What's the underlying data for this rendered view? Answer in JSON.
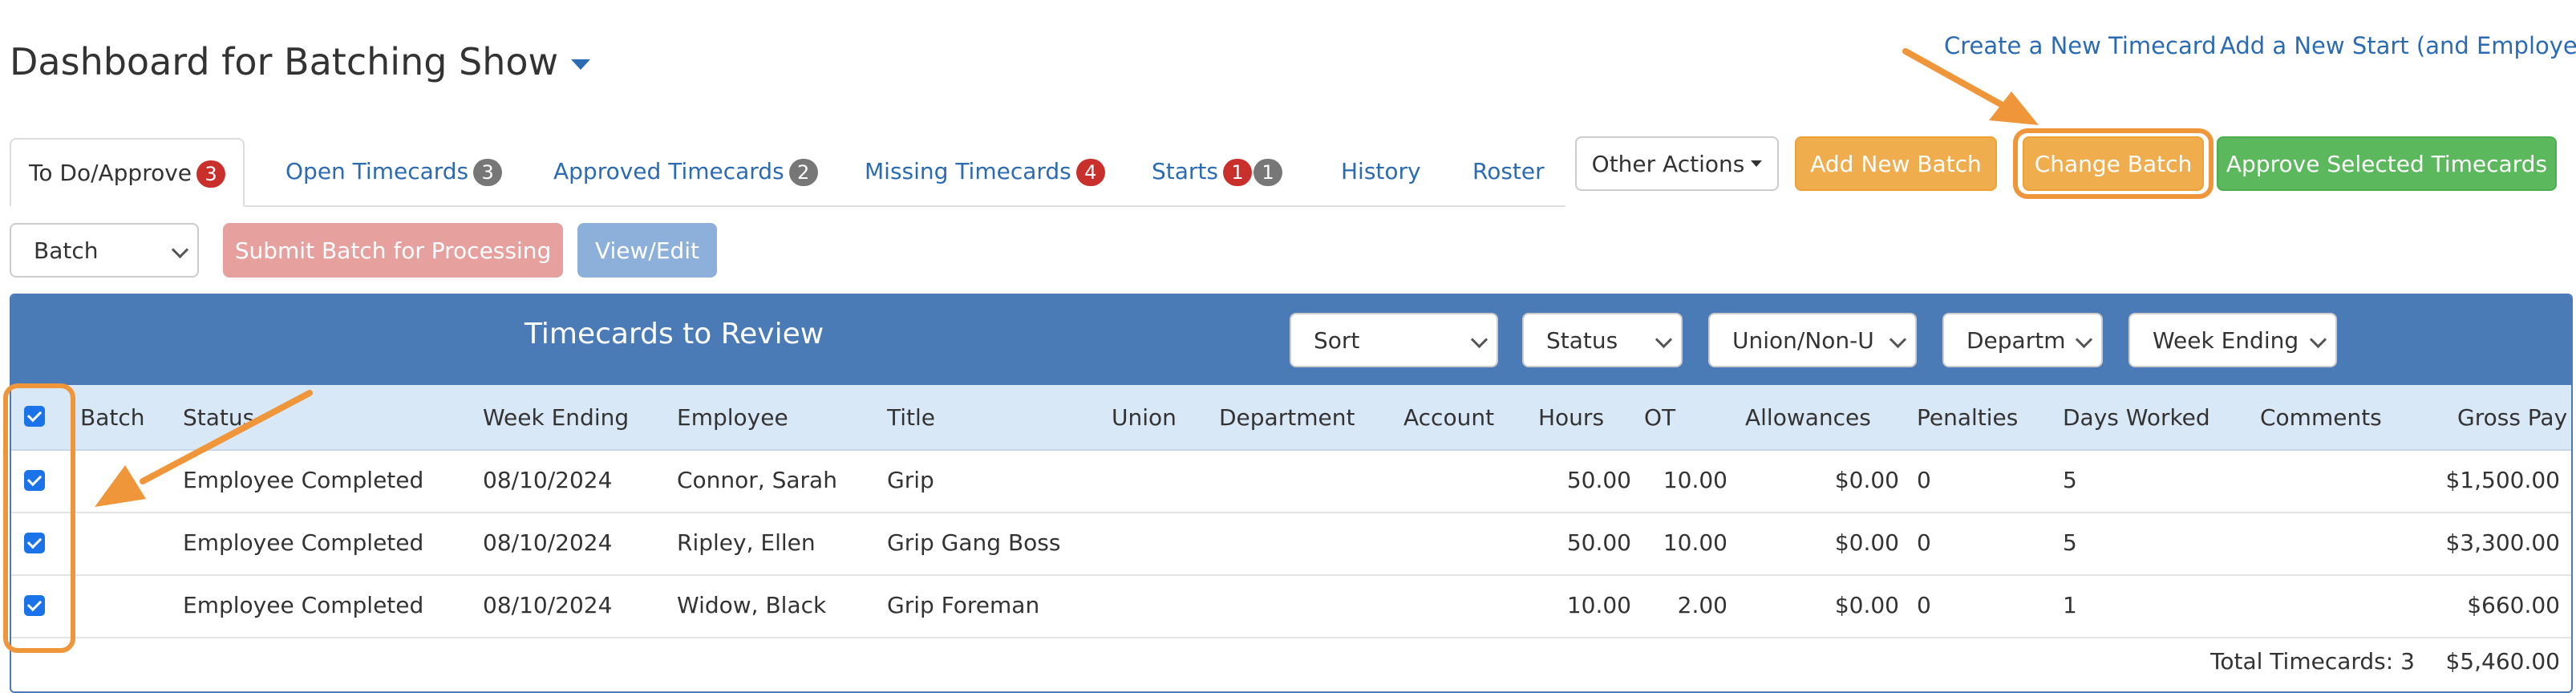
{
  "header": {
    "title": "Dashboard for Batching Show",
    "links": {
      "create_timecard": "Create a New Timecard",
      "add_start": "Add a New Start (and Employee)"
    }
  },
  "tabs": [
    {
      "label": "To Do/Approve",
      "badges": [
        {
          "value": "3",
          "color": "red"
        }
      ]
    },
    {
      "label": "Open Timecards",
      "badges": [
        {
          "value": "3",
          "color": "gray"
        }
      ]
    },
    {
      "label": "Approved Timecards",
      "badges": [
        {
          "value": "2",
          "color": "gray"
        }
      ]
    },
    {
      "label": "Missing Timecards",
      "badges": [
        {
          "value": "4",
          "color": "red"
        }
      ]
    },
    {
      "label": "Starts",
      "badges": [
        {
          "value": "1",
          "color": "red"
        },
        {
          "value": "1",
          "color": "gray"
        }
      ]
    },
    {
      "label": "History",
      "badges": []
    },
    {
      "label": "Roster",
      "badges": []
    }
  ],
  "actions": {
    "other_actions": "Other Actions",
    "add_new_batch": "Add New Batch",
    "change_batch": "Change Batch",
    "approve_selected": "Approve Selected Timecards"
  },
  "batch_bar": {
    "batch_select": "Batch",
    "submit": "Submit Batch for Processing",
    "view_edit": "View/Edit"
  },
  "panel": {
    "title": "Timecards to Review",
    "filters": {
      "sort": "Sort",
      "status": "Status",
      "union": "Union/Non-U",
      "department": "Departm",
      "week_ending": "Week Ending"
    },
    "columns": {
      "batch": "Batch",
      "status": "Status",
      "week_ending": "Week Ending",
      "employee": "Employee",
      "title": "Title",
      "union": "Union",
      "department": "Department",
      "account": "Account",
      "hours": "Hours",
      "ot": "OT",
      "allowances": "Allowances",
      "penalties": "Penalties",
      "days_worked": "Days Worked",
      "comments": "Comments",
      "gross_pay": "Gross Pay"
    },
    "rows": [
      {
        "checked": true,
        "status": "Employee Completed",
        "week_ending": "08/10/2024",
        "employee": "Connor, Sarah",
        "title": "Grip",
        "hours": "50.00",
        "ot": "10.00",
        "allowances": "$0.00",
        "penalties": "0",
        "days_worked": "5",
        "gross_pay": "$1,500.00"
      },
      {
        "checked": true,
        "status": "Employee Completed",
        "week_ending": "08/10/2024",
        "employee": "Ripley, Ellen",
        "title": "Grip Gang Boss",
        "hours": "50.00",
        "ot": "10.00",
        "allowances": "$0.00",
        "penalties": "0",
        "days_worked": "5",
        "gross_pay": "$3,300.00"
      },
      {
        "checked": true,
        "status": "Employee Completed",
        "week_ending": "08/10/2024",
        "employee": "Widow, Black",
        "title": "Grip Foreman",
        "hours": "10.00",
        "ot": "2.00",
        "allowances": "$0.00",
        "penalties": "0",
        "days_worked": "1",
        "gross_pay": "$660.00"
      }
    ],
    "footer": {
      "total_label": "Total Timecards: 3",
      "total_gross": "$5,460.00"
    }
  },
  "colors": {
    "accent": "#2a6bb3",
    "panel": "#4a7bb7",
    "annotation": "#f0963a",
    "orange_button": "#f0ad4e",
    "green_button": "#5cb85c"
  }
}
